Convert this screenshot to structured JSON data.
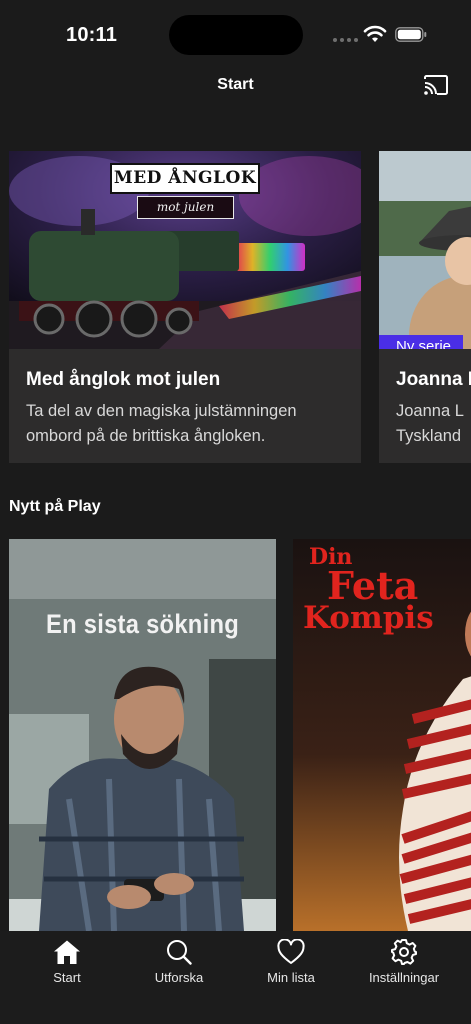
{
  "status_bar": {
    "time": "10:11"
  },
  "header": {
    "title": "Start",
    "cast_icon": "cast-icon"
  },
  "featured": [
    {
      "logo_title": "MED ÅNGLOK",
      "logo_subtitle": "mot julen",
      "title": "Med ånglok mot julen",
      "description": "Ta del av den magiska julstämningen ombord på de brittiska ångloken."
    },
    {
      "badge": "Ny serie",
      "title": "Joanna L",
      "description": "Joanna L\nTyskland"
    }
  ],
  "section": {
    "title": "Nytt på Play"
  },
  "posters": [
    {
      "title": "En sista sökning"
    },
    {
      "title_line1": "Din",
      "title_line2": "Feta",
      "title_line3": "Kompis"
    }
  ],
  "tabs": [
    {
      "label": "Start",
      "icon": "home-icon",
      "active": true
    },
    {
      "label": "Utforska",
      "icon": "search-icon",
      "active": false
    },
    {
      "label": "Min lista",
      "icon": "heart-icon",
      "active": false
    },
    {
      "label": "Inställningar",
      "icon": "gear-icon",
      "active": false
    }
  ],
  "colors": {
    "background": "#1b1b1b",
    "card": "#2d2c2c",
    "badge": "#4a2ee6",
    "poster_red": "#e1241e"
  }
}
